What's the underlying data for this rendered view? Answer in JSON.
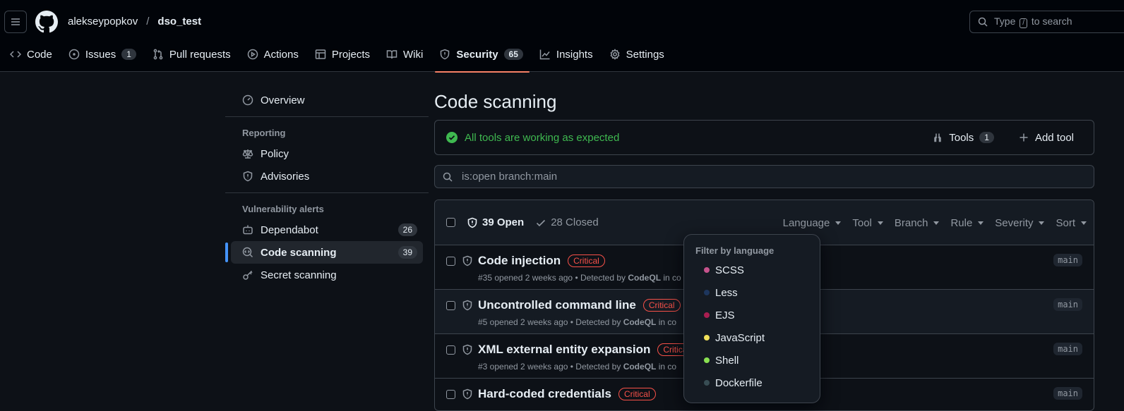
{
  "header": {
    "owner": "alekseypopkov",
    "separator": "/",
    "repo": "dso_test",
    "search": {
      "before": "Type",
      "key": "/",
      "after": "to search"
    }
  },
  "repo_nav": [
    {
      "label": "Code",
      "icon": "code-icon"
    },
    {
      "label": "Issues",
      "icon": "issue-opened-icon",
      "count": "1"
    },
    {
      "label": "Pull requests",
      "icon": "git-pull-request-icon"
    },
    {
      "label": "Actions",
      "icon": "play-icon"
    },
    {
      "label": "Projects",
      "icon": "table-icon"
    },
    {
      "label": "Wiki",
      "icon": "book-icon"
    },
    {
      "label": "Security",
      "icon": "shield-icon",
      "count": "65",
      "active": true
    },
    {
      "label": "Insights",
      "icon": "graph-icon"
    },
    {
      "label": "Settings",
      "icon": "gear-icon"
    }
  ],
  "sidebar": {
    "overview": "Overview",
    "reporting_heading": "Reporting",
    "policy": "Policy",
    "advisories": "Advisories",
    "vuln_heading": "Vulnerability alerts",
    "dependabot": {
      "label": "Dependabot",
      "count": "26"
    },
    "code_scanning": {
      "label": "Code scanning",
      "count": "39"
    },
    "secret_scanning": "Secret scanning"
  },
  "main": {
    "title": "Code scanning",
    "status": "All tools are working as expected",
    "tools_label": "Tools",
    "tools_count": "1",
    "add_tool": "Add tool",
    "filter": "is:open branch:main"
  },
  "alerts": {
    "open_label": "39 Open",
    "closed_label": "28 Closed",
    "filters": [
      "Language",
      "Tool",
      "Branch",
      "Rule",
      "Severity",
      "Sort"
    ],
    "rows": [
      {
        "title": "Code injection",
        "severity": "Critical",
        "meta_pre": "#35 opened 2 weeks ago • Detected by ",
        "tool": "CodeQL",
        "meta_post": " in co",
        "branch": "main"
      },
      {
        "title": "Uncontrolled command line",
        "severity": "Critical",
        "meta_pre": "#5 opened 2 weeks ago • Detected by ",
        "tool": "CodeQL",
        "meta_post": " in co",
        "branch": "main"
      },
      {
        "title": "XML external entity expansion",
        "severity": "Critica",
        "meta_pre": "#3 opened 2 weeks ago • Detected by ",
        "tool": "CodeQL",
        "meta_post": " in co",
        "branch": "main"
      },
      {
        "title": "Hard-coded credentials",
        "severity": "Critical",
        "meta_pre": "",
        "tool": "",
        "meta_post": "",
        "branch": "main"
      }
    ]
  },
  "language_menu": {
    "title": "Filter by language",
    "items": [
      {
        "label": "SCSS",
        "color": "#c6538c"
      },
      {
        "label": "Less",
        "color": "#1d365d"
      },
      {
        "label": "EJS",
        "color": "#a91e50"
      },
      {
        "label": "JavaScript",
        "color": "#f1e05a"
      },
      {
        "label": "Shell",
        "color": "#89e051"
      },
      {
        "label": "Dockerfile",
        "color": "#384d54"
      }
    ]
  },
  "colors": {
    "accent": "#f78166",
    "success": "#3fb950",
    "danger": "#f85149",
    "link": "#4493f8"
  }
}
